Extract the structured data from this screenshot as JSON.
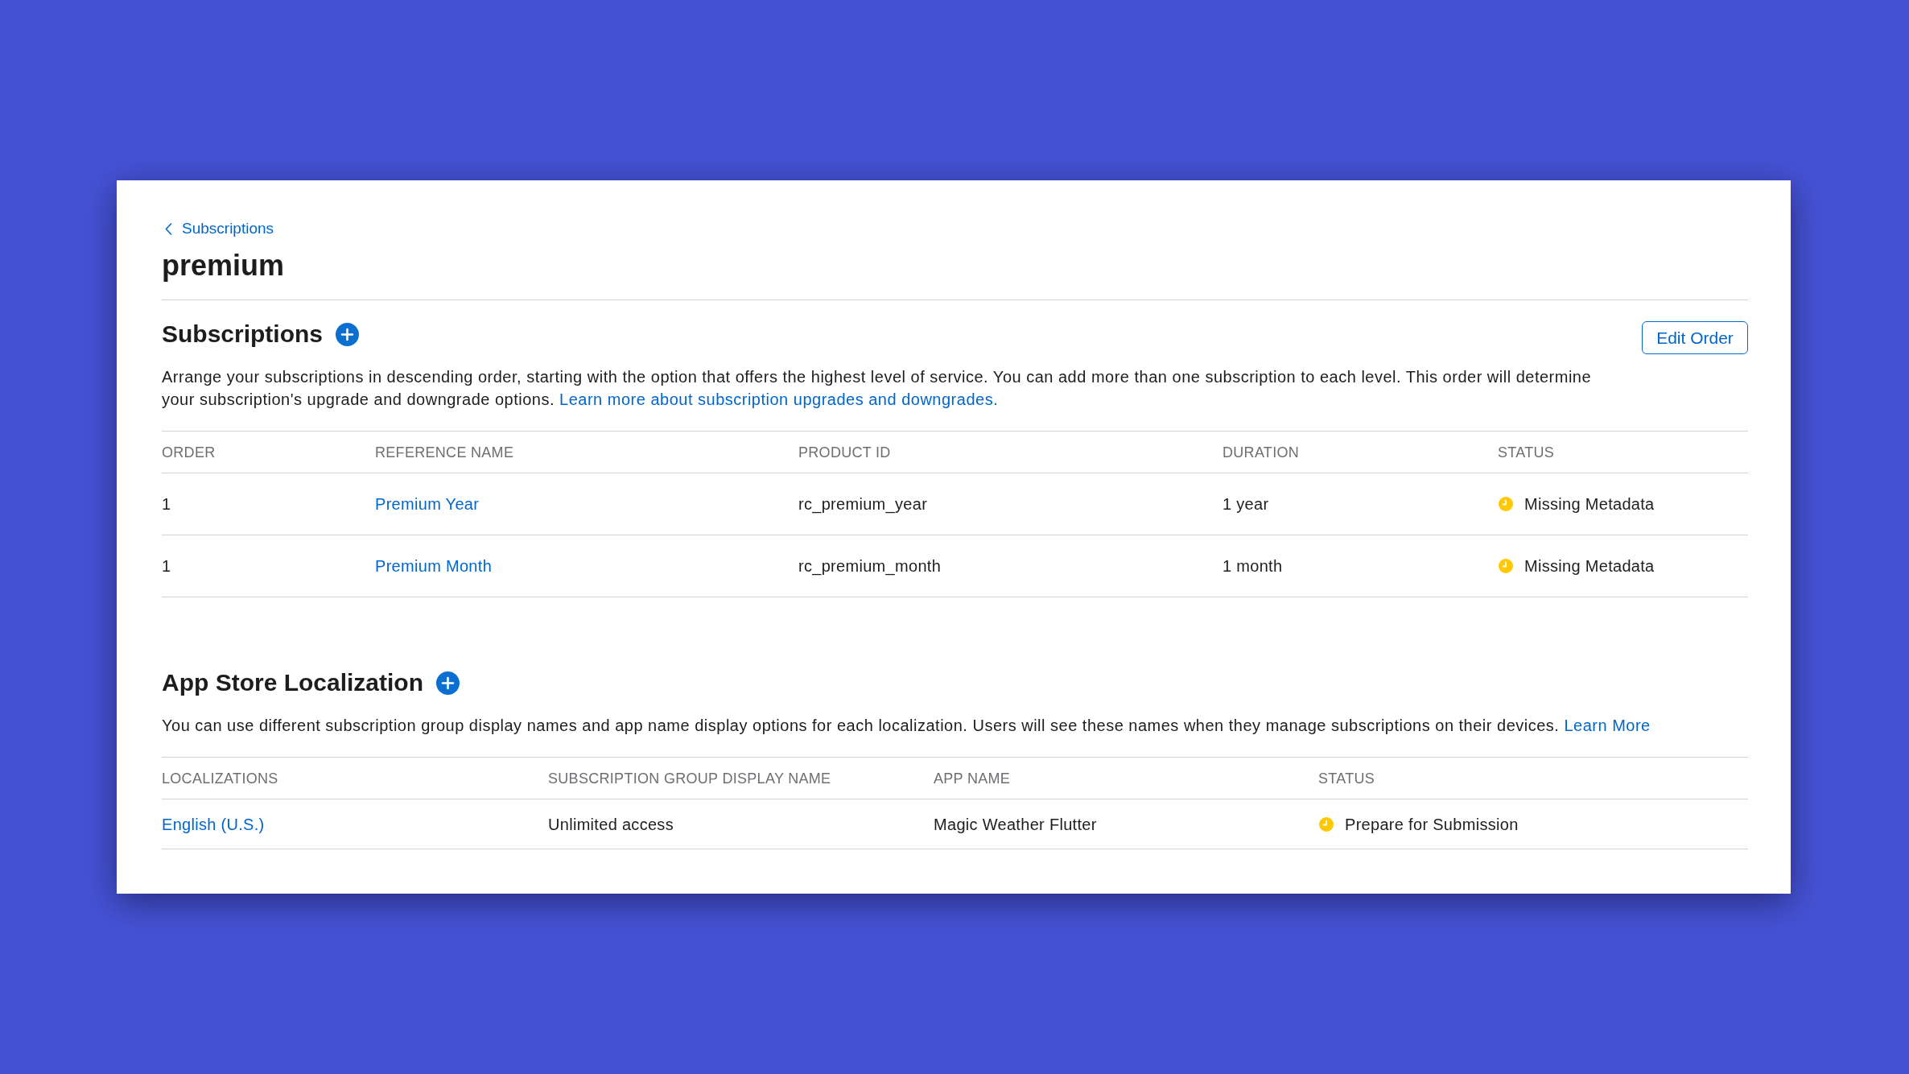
{
  "breadcrumb": {
    "label": "Subscriptions"
  },
  "title": "premium",
  "sections": [
    {
      "heading": "Subscriptions",
      "button": "Edit Order",
      "description": "Arrange your subscriptions in descending order, starting with the option that offers the highest level of service. You can add more than one subscription to each level. This order will determine your subscription's upgrade and downgrade options.",
      "link": "Learn more about subscription upgrades and downgrades.",
      "table": {
        "columns": [
          {
            "label": "ORDER",
            "kind": "text"
          },
          {
            "label": "REFERENCE NAME",
            "kind": "link"
          },
          {
            "label": "PRODUCT ID",
            "kind": "text"
          },
          {
            "label": "DURATION",
            "kind": "text"
          },
          {
            "label": "STATUS",
            "kind": "status"
          }
        ],
        "rows": [
          {
            "cells": [
              "1",
              "Premium Year",
              "rc_premium_year",
              "1 year",
              "Missing Metadata"
            ]
          },
          {
            "cells": [
              "1",
              "Premium Month",
              "rc_premium_month",
              "1 month",
              "Missing Metadata"
            ]
          }
        ]
      }
    },
    {
      "heading": "App Store Localization",
      "description": "You can use different subscription group display names and app name display options for each localization. Users will see these names when they manage subscriptions on their devices.",
      "link": "Learn More",
      "table": {
        "columns": [
          {
            "label": "LOCALIZATIONS",
            "kind": "link"
          },
          {
            "label": "SUBSCRIPTION GROUP DISPLAY NAME",
            "kind": "text"
          },
          {
            "label": "APP NAME",
            "kind": "text"
          },
          {
            "label": "STATUS",
            "kind": "status"
          }
        ],
        "rows": [
          {
            "cells": [
              "English (U.S.)",
              "Unlimited access",
              "Magic Weather Flutter",
              "Prepare for Submission"
            ]
          }
        ]
      }
    }
  ]
}
